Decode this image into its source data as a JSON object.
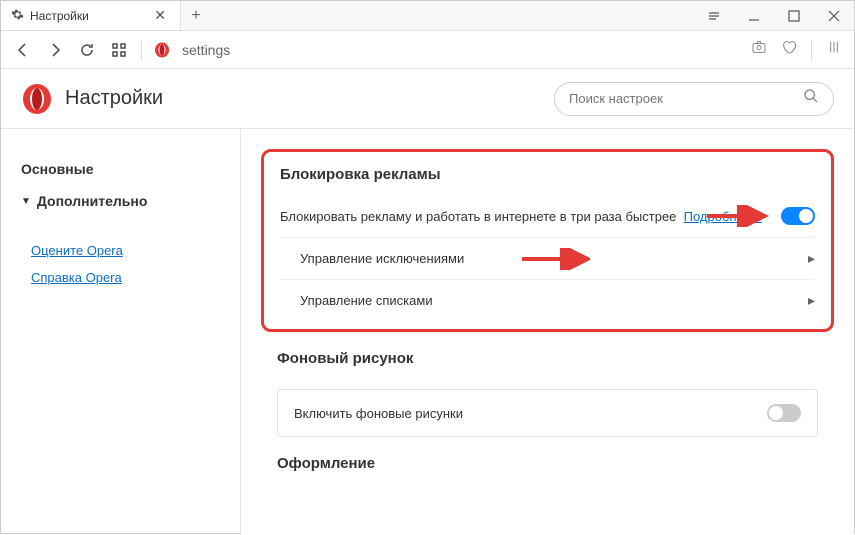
{
  "window": {
    "tab_title": "Настройки"
  },
  "addressbar": {
    "url_text": "settings"
  },
  "page": {
    "title": "Настройки",
    "search_placeholder": "Поиск настроек"
  },
  "sidebar": {
    "basic": "Основные",
    "advanced": "Дополнительно",
    "rate": "Оцените Opera",
    "help": "Справка Opera"
  },
  "adblock": {
    "heading": "Блокировка рекламы",
    "desc": "Блокировать рекламу и работать в интернете в три раза быстрее",
    "learn": "Подробнее...",
    "exceptions": "Управление исключениями",
    "lists": "Управление списками"
  },
  "wallpaper": {
    "heading": "Фоновый рисунок",
    "enable": "Включить фоновые рисунки"
  },
  "theme": {
    "heading": "Оформление"
  }
}
